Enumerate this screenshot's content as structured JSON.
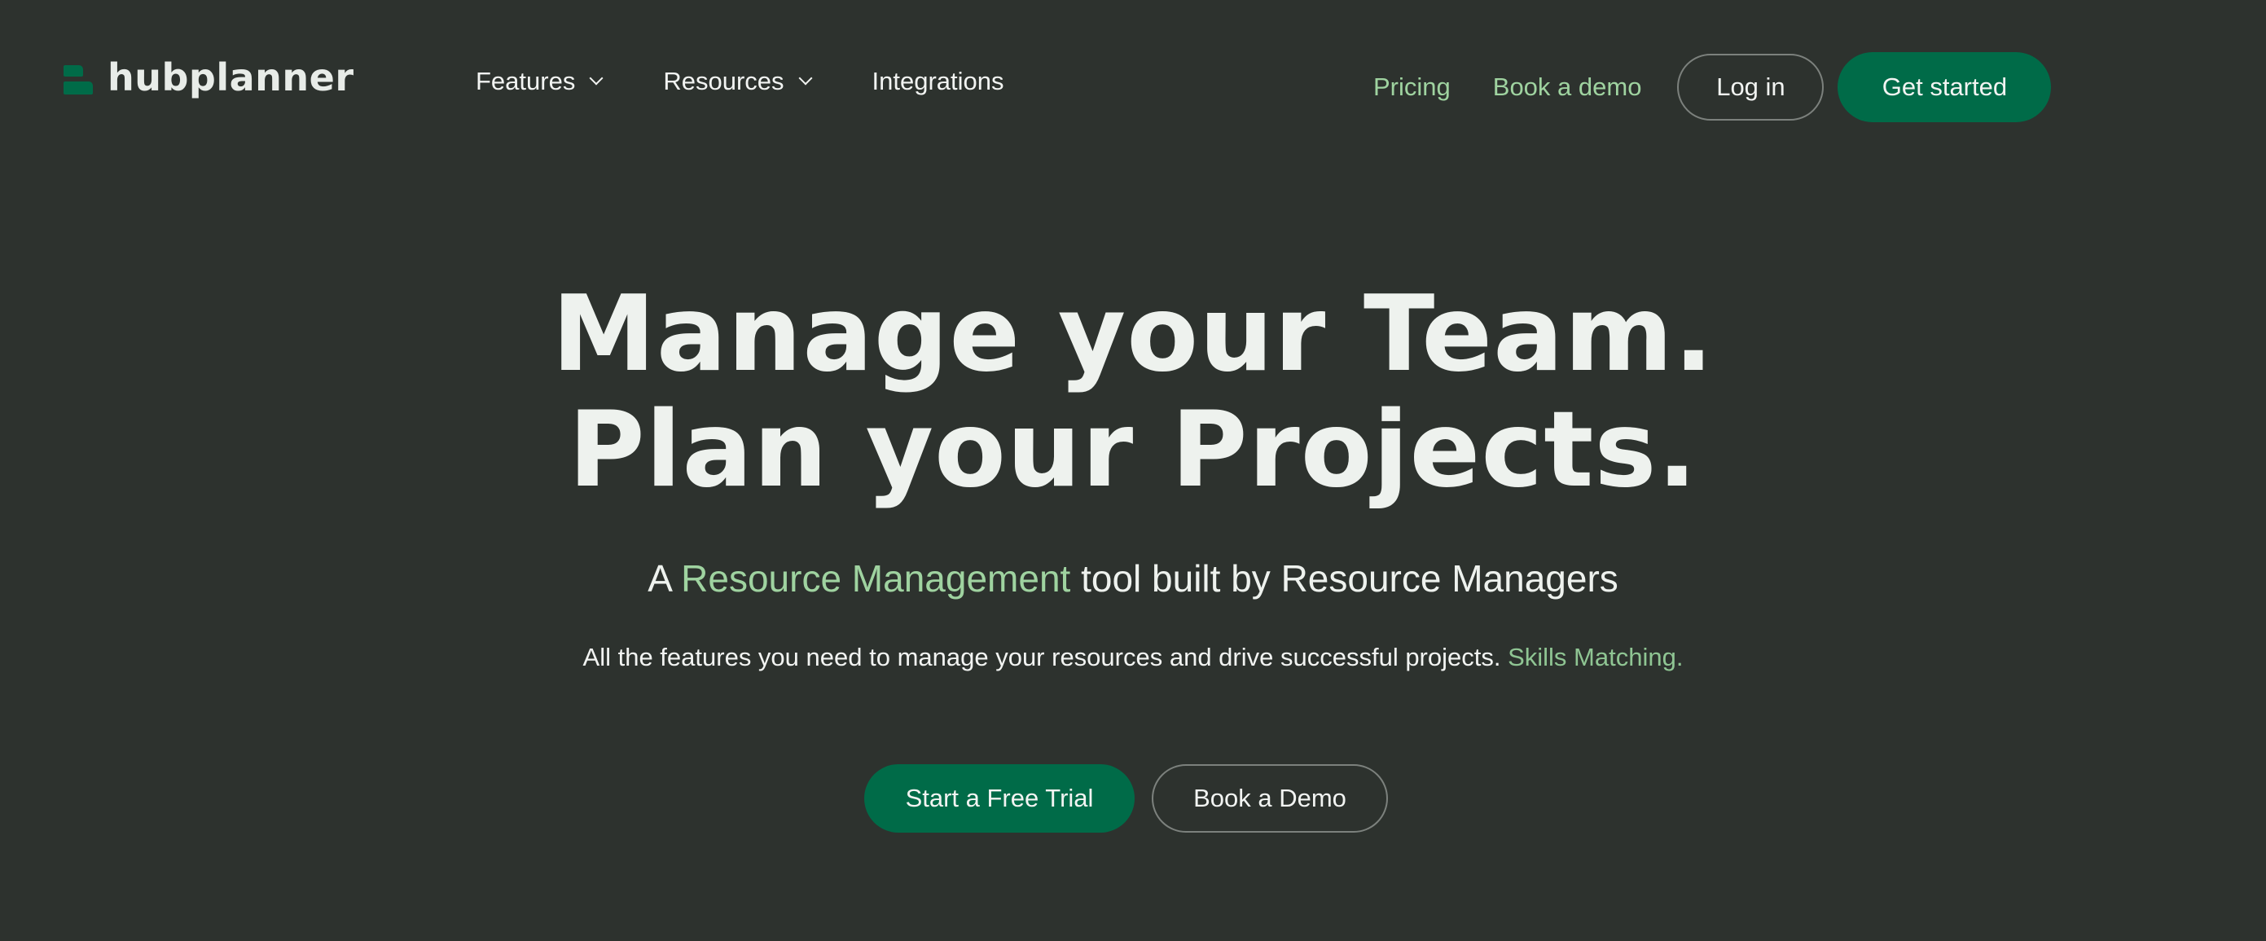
{
  "brand": {
    "name": "hubplanner",
    "logo_icon": "hubplanner-logo-mark",
    "accent_color": "#006b48",
    "highlight_color": "#9fd3a0",
    "background_color": "#2d322e"
  },
  "nav": {
    "links": [
      {
        "label": "Features",
        "has_dropdown": true,
        "icon": "chevron-down-icon"
      },
      {
        "label": "Resources",
        "has_dropdown": true,
        "icon": "chevron-down-icon"
      },
      {
        "label": "Integrations",
        "has_dropdown": false
      }
    ],
    "pricing_label": "Pricing",
    "book_demo_label": "Book a demo",
    "login_label": "Log in",
    "get_started_label": "Get started"
  },
  "hero": {
    "title_line1": "Manage your Team.",
    "title_line2": "Plan your Projects.",
    "subtitle_prefix": "A ",
    "subtitle_highlight": "Resource Management",
    "subtitle_suffix": " tool built by Resource Managers",
    "description": "All the features you need to manage your resources and drive successful projects. ",
    "description_highlight": "Skills Matching.",
    "cta_primary": "Start a Free Trial",
    "cta_secondary": "Book a Demo"
  }
}
